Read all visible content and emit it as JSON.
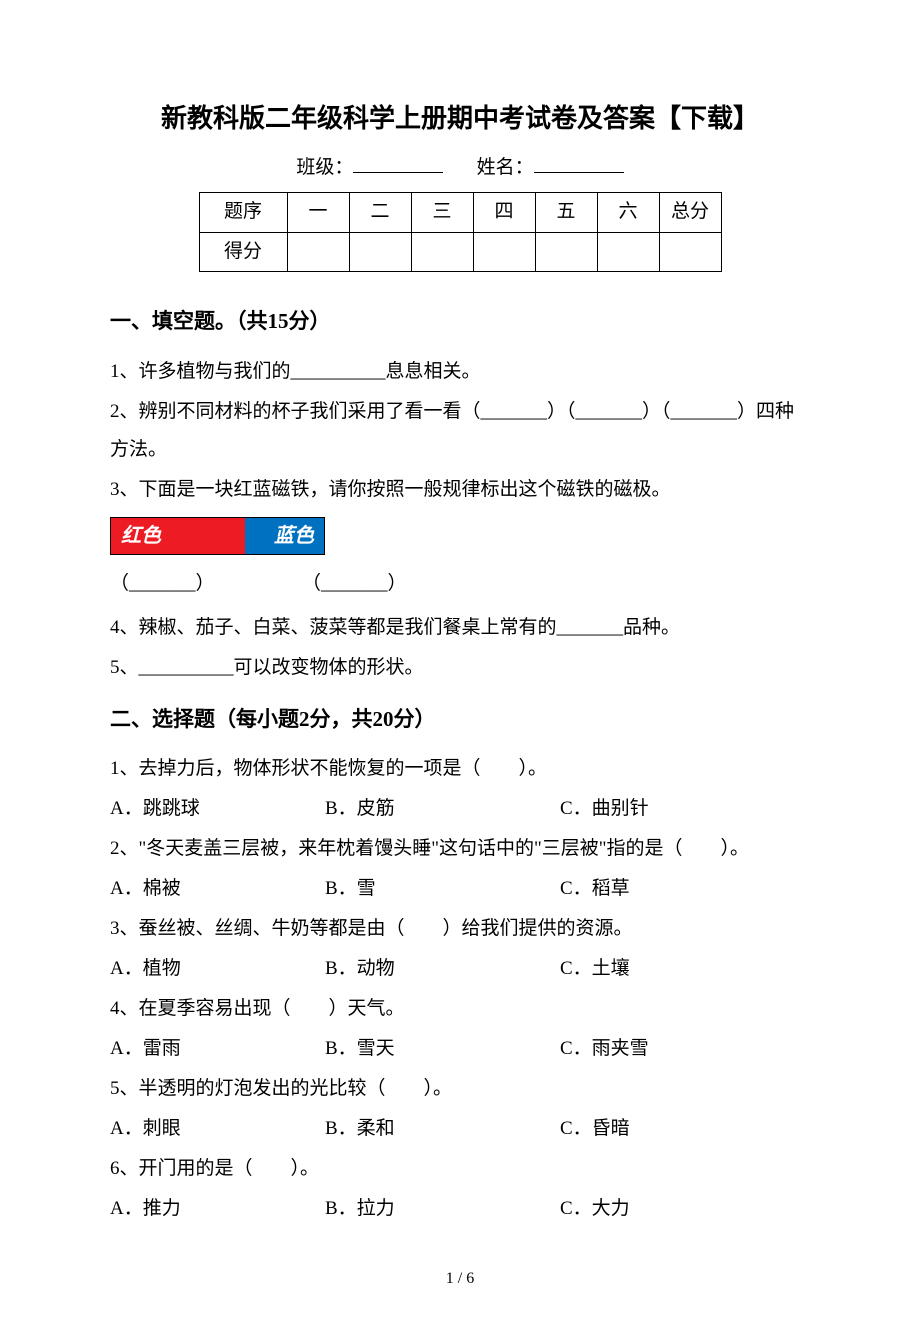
{
  "title": "新教科版二年级科学上册期中考试卷及答案【下载】",
  "class_label": "班级：",
  "name_label": "姓名：",
  "score_table": {
    "headers": [
      "题序",
      "一",
      "二",
      "三",
      "四",
      "五",
      "六",
      "总分"
    ],
    "row2_label": "得分"
  },
  "section1": {
    "heading": "一、填空题。（共15分）",
    "q1": "1、许多植物与我们的__________息息相关。",
    "q2": "2、辨别不同材料的杯子我们采用了看一看（_______）（_______）（_______）四种方法。",
    "q3": "3、下面是一块红蓝磁铁，请你按照一般规律标出这个磁铁的磁极。",
    "magnet_red": "红色",
    "magnet_blue": "蓝色",
    "magnet_blank_left": "（_______）",
    "magnet_blank_right": "（_______）",
    "q4": "4、辣椒、茄子、白菜、菠菜等都是我们餐桌上常有的_______品种。",
    "q5": "5、__________可以改变物体的形状。"
  },
  "section2": {
    "heading": "二、选择题（每小题2分，共20分）",
    "q1": {
      "stem": "1、去掉力后，物体形状不能恢复的一项是（　　）。",
      "a": "A．跳跳球",
      "b": "B．皮筋",
      "c": "C．曲别针"
    },
    "q2": {
      "stem": "2、\"冬天麦盖三层被，来年枕着馒头睡\"这句话中的\"三层被\"指的是（　　）。",
      "a": "A．棉被",
      "b": "B．雪",
      "c": "C．稻草"
    },
    "q3": {
      "stem": "3、蚕丝被、丝绸、牛奶等都是由（　　）给我们提供的资源。",
      "a": "A．植物",
      "b": "B．动物",
      "c": "C．土壤"
    },
    "q4": {
      "stem": "4、在夏季容易出现（　　）天气。",
      "a": "A．雷雨",
      "b": "B．雪天",
      "c": "C．雨夹雪"
    },
    "q5": {
      "stem": "5、半透明的灯泡发出的光比较（　　）。",
      "a": "A．刺眼",
      "b": "B．柔和",
      "c": "C．昏暗"
    },
    "q6": {
      "stem": "6、开门用的是（　　）。",
      "a": "A．推力",
      "b": "B．拉力",
      "c": "C．大力"
    }
  },
  "page_number": "1 / 6"
}
